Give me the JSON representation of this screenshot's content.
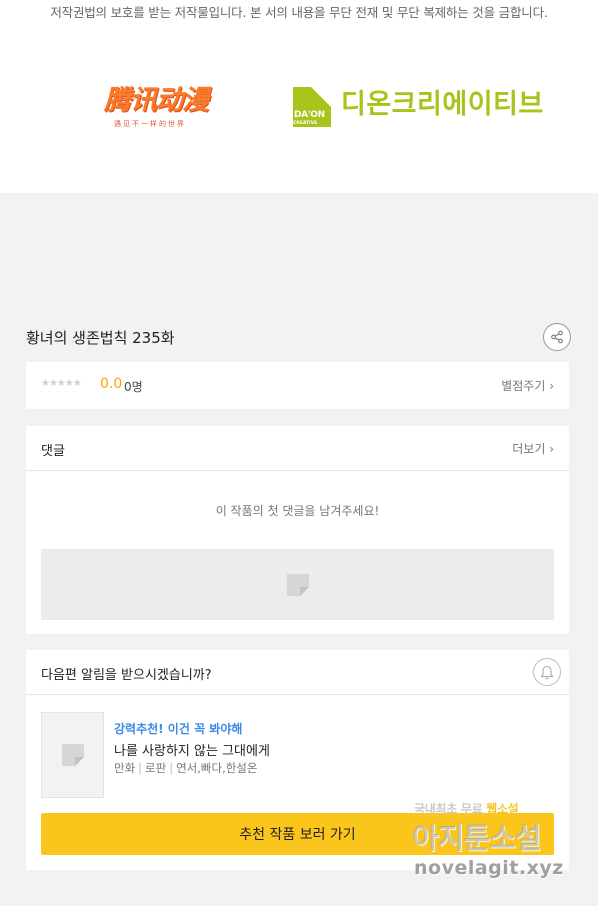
{
  "copyright_notice": "저작권법의 보호를 받는 저작물입니다. 본 서의 내용을 무단 전재 및 무단 복제하는 것을 금합니다.",
  "logos": {
    "tencent": {
      "main": "腾讯动漫",
      "sub": "遇见不一样的世界"
    },
    "daon": {
      "mark_word": "DA'ON",
      "mark_sub": "CREATIVE",
      "name": "디온크리에이티브",
      "color": "#a6c419"
    }
  },
  "episode": {
    "title": "황녀의 생존법칙 235화",
    "share_icon": "share-icon"
  },
  "rating": {
    "stars": "★★★★★",
    "score": "0.0",
    "count": "0명",
    "rate_link": "별점주기 ›"
  },
  "comments": {
    "label": "댓글",
    "more": "더보기 ›",
    "empty_message": "이 작품의 첫 댓글을 남겨주세요!"
  },
  "notify": {
    "question": "다음편 알림을 받으시겠습니까?",
    "bell_icon": "bell-icon"
  },
  "recommend": {
    "tag": "강력추천! 이건 꼭 봐야해",
    "title": "나를 사랑하지 않는 그대에게",
    "meta": [
      "만화",
      "로판",
      "연서,빠다,한설온"
    ],
    "button": "추천 작품 보러 가기"
  },
  "watermark": {
    "line1_prefix": "국내최초 무료 ",
    "line1_highlight": "웹소설",
    "line2": "아지툰소설",
    "line3": "novelagit.xyz"
  },
  "colors": {
    "accent_yellow": "#fbc61c",
    "score_orange": "#f5a500",
    "tag_blue": "#3d8ae6"
  }
}
